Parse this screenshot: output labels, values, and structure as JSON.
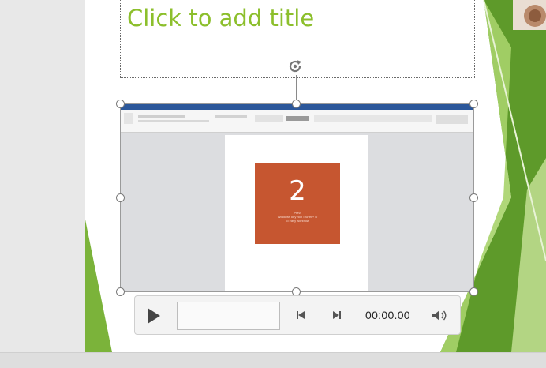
{
  "slide": {
    "title_placeholder": "Click to add title"
  },
  "video": {
    "slide_number": "2",
    "card_lines": [
      "Prev.",
      "Windows key hop • Shift + D",
      "to easy workflow"
    ]
  },
  "media_controls": {
    "time": "00:00.00",
    "progress": 0
  },
  "colors": {
    "title_green": "#8cbf2c",
    "accent_green": "#7bb33a",
    "card_orange": "#c65630",
    "ribbon_blue": "#2b579a"
  },
  "icons": {
    "rotate": "rotate-icon",
    "play": "play-icon",
    "back": "skip-back-icon",
    "forward": "skip-forward-icon",
    "volume": "volume-icon"
  }
}
